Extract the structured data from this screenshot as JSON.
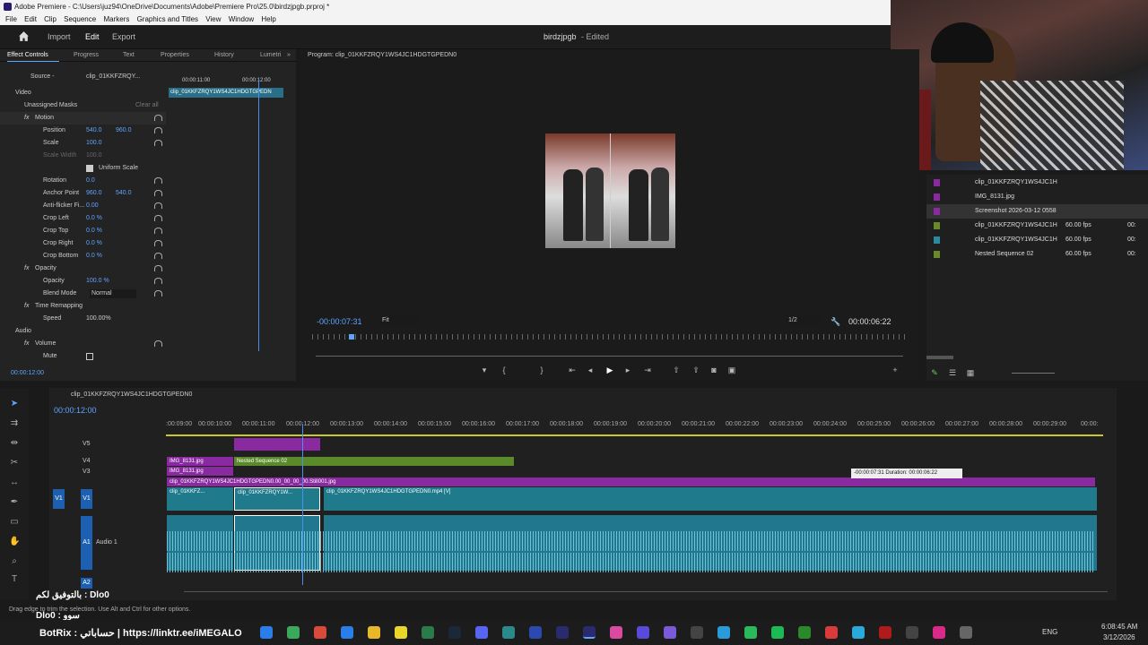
{
  "window": {
    "title": "Adobe Premiere - C:\\Users\\juz94\\OneDrive\\Documents\\Adobe\\Premiere Pro\\25.0\\birdzjpgb.prproj *"
  },
  "menu": [
    "File",
    "Edit",
    "Clip",
    "Sequence",
    "Markers",
    "Graphics and Titles",
    "View",
    "Window",
    "Help"
  ],
  "workspaces": {
    "import": "Import",
    "edit": "Edit",
    "export": "Export",
    "project_title": "birdzjpgb",
    "project_state": "- Edited"
  },
  "effect_controls": {
    "tabs": [
      "Effect Controls",
      "Progress",
      "Text",
      "Properties",
      "History",
      "Lumetri"
    ],
    "source_label": "Source -",
    "clip_label": "clip_01KKFZRQY...",
    "mini_ruler": [
      "00:00:11:00",
      "00:00:12:00"
    ],
    "mini_clip": "clip_01KKFZRQY1WS4JC1HDGTGPEDN",
    "video_header": "Video",
    "unassigned_masks": "Unassigned Masks",
    "clear_all": "Clear all",
    "motion": "Motion",
    "position": {
      "label": "Position",
      "x": "540.0",
      "y": "960.0"
    },
    "scale": {
      "label": "Scale",
      "value": "100.0"
    },
    "scale_width": {
      "label": "Scale Width",
      "value": "100.0"
    },
    "uniform": "Uniform Scale",
    "rotation": {
      "label": "Rotation",
      "value": "0.0"
    },
    "anchor": {
      "label": "Anchor Point",
      "x": "960.0",
      "y": "540.0"
    },
    "antiflicker": {
      "label": "Anti-flicker Fi...",
      "value": "0.00"
    },
    "crop_left": {
      "label": "Crop Left",
      "value": "0.0 %"
    },
    "crop_top": {
      "label": "Crop Top",
      "value": "0.0 %"
    },
    "crop_right": {
      "label": "Crop Right",
      "value": "0.0 %"
    },
    "crop_bottom": {
      "label": "Crop Bottom",
      "value": "0.0 %"
    },
    "opacity_header": "Opacity",
    "opacity": {
      "label": "Opacity",
      "value": "100.0 %"
    },
    "blend": {
      "label": "Blend Mode",
      "value": "Normal"
    },
    "time_remap": "Time Remapping",
    "speed": {
      "label": "Speed",
      "value": "100.00%"
    },
    "audio_header": "Audio",
    "volume": "Volume",
    "mute": "Mute",
    "timecode": "00:00:12:00"
  },
  "program": {
    "title": "Program: clip_01KKFZRQY1WS4JC1HDGTGPEDN0",
    "timecode": "-00:00:07:31",
    "fit": "Fit",
    "quality": "1/2",
    "duration": "00:00:06:22"
  },
  "project_items": [
    {
      "name": "clip_01KKFZRQY1WS4JC1H",
      "fps": "",
      "extra": "",
      "color": "#8a2aa0"
    },
    {
      "name": "IMG_8131.jpg",
      "fps": "",
      "extra": "",
      "color": "#8a2aa0"
    },
    {
      "name": "Screenshot 2026-03-12 0558",
      "fps": "",
      "extra": "",
      "color": "#8a2aa0"
    },
    {
      "name": "clip_01KKFZRQY1WS4JC1H",
      "fps": "60.00 fps",
      "extra": "00:",
      "color": "#6a8a2a"
    },
    {
      "name": "clip_01KKFZRQY1WS4JC1H",
      "fps": "60.00 fps",
      "extra": "00:",
      "color": "#2a8aa0"
    },
    {
      "name": "Nested Sequence 02",
      "fps": "60.00 fps",
      "extra": "00:",
      "color": "#6a8a2a"
    }
  ],
  "timeline": {
    "sequence": "clip_01KKFZRQY1WS4JC1HDGTGPEDN0",
    "timecode": "00:00:12:00",
    "ruler": [
      ":00:09:00",
      "00:00:10:00",
      "00:00:11:00",
      "00:00:12:00",
      "00:00:13:00",
      "00:00:14:00",
      "00:00:15:00",
      "00:00:16:00",
      "00:00:17:00",
      "00:00:18:00",
      "00:00:19:00",
      "00:00:20:00",
      "00:00:21:00",
      "00:00:22:00",
      "00:00:23:00",
      "00:00:24:00",
      "00:00:25:00",
      "00:00:26:00",
      "00:00:27:00",
      "00:00:28:00",
      "00:00:29:00",
      "00:00:"
    ],
    "tracks": {
      "v5": "V5",
      "v4": "V4",
      "v3": "V3",
      "v1": "V1",
      "a1": "A1",
      "a1name": "Audio 1",
      "a2": "A2"
    },
    "clips": {
      "img1": "IMG_8131.jpg",
      "img2": "IMG_8131.jpg",
      "nested": "Nested Sequence 02",
      "long_purple": "clip_01KKFZRQY1WS4JC1HDGTGPEDN0.00_00_00_00.Still001.jpg",
      "v1a": "clip_01KKFZ...",
      "v1b": "clip_01KKFZRQY1W...",
      "v1c": "clip_01KKFZRQY1WS4JC1HDGTGPEDN0.mp4 [V]"
    },
    "tooltip": "-00:00:07:31  Duration: 00:00:06:22"
  },
  "overlay": {
    "line1": "بالتوفيق لكم : Dlo0",
    "line2": "Dlo0 : سوو",
    "botrix": "BotRix : حساباتي | https://linktr.ee/iMEGALO"
  },
  "status": "Drag edge to trim the selection. Use Alt and Ctrl for other options.",
  "tray": {
    "lang": "ENG",
    "time": "6:08:45 AM",
    "date": "3/12/2026"
  }
}
